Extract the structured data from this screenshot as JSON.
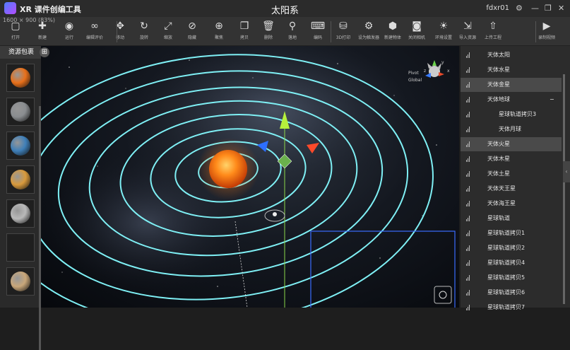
{
  "app": {
    "name": "XR 课件创编工具",
    "title": "太阳系",
    "user": "fdxr01",
    "resolution": "1600 × 900 (83%)"
  },
  "toolbar": [
    {
      "label": "打开",
      "icon": "folder-icon",
      "glyph": "▢"
    },
    {
      "label": "新建",
      "icon": "new-file-icon",
      "glyph": "✚"
    },
    {
      "label": "运行",
      "icon": "eye-icon",
      "glyph": "◉"
    },
    {
      "label": "编辑评价",
      "icon": "link-icon",
      "glyph": "∞"
    },
    {
      "label": "移动",
      "icon": "move-icon",
      "glyph": "✥"
    },
    {
      "label": "旋转",
      "icon": "rotate-icon",
      "glyph": "↻"
    },
    {
      "label": "缩放",
      "icon": "scale-icon",
      "glyph": "⤢"
    },
    {
      "label": "隐藏",
      "icon": "hide-icon",
      "glyph": "⊘"
    },
    {
      "label": "聚焦",
      "icon": "focus-icon",
      "glyph": "⊕"
    },
    {
      "label": "拷贝",
      "icon": "copy-icon",
      "glyph": "❐"
    },
    {
      "label": "删除",
      "icon": "delete-icon",
      "glyph": "🗑"
    },
    {
      "label": "落地",
      "icon": "pin-icon",
      "glyph": "⚲"
    },
    {
      "label": "编码",
      "icon": "code-icon",
      "glyph": "⌨"
    },
    {
      "label": "3D打印",
      "icon": "print3d-icon",
      "glyph": "⛁"
    },
    {
      "label": "设为触发器",
      "icon": "trigger-icon",
      "glyph": "⚙"
    },
    {
      "label": "新建物体",
      "icon": "cube-icon",
      "glyph": "⬢"
    },
    {
      "label": "关闭相机",
      "icon": "camera-icon",
      "glyph": "◙"
    },
    {
      "label": "环境设置",
      "icon": "sun-icon",
      "glyph": "☀"
    },
    {
      "label": "导入资源",
      "icon": "import-icon",
      "glyph": "⇲"
    },
    {
      "label": "上传工程",
      "icon": "upload-icon",
      "glyph": "⇧"
    },
    {
      "label": "录制视频",
      "icon": "video-icon",
      "glyph": "▶"
    }
  ],
  "resources": {
    "title": "资源包裹",
    "items": [
      {
        "name": "sun",
        "color": "#e8701a"
      },
      {
        "name": "mercury",
        "color": "#8a8d90"
      },
      {
        "name": "earth",
        "color": "#3f7fb8"
      },
      {
        "name": "venus",
        "color": "#d99a3c"
      },
      {
        "name": "moon",
        "color": "#b9b9b9"
      },
      {
        "name": "empty",
        "color": ""
      },
      {
        "name": "jupiter",
        "color": "#c9a77a"
      }
    ]
  },
  "hierarchy": {
    "items": [
      {
        "label": "天体太阳",
        "indent": 0,
        "selected": false,
        "toggle": ""
      },
      {
        "label": "天体水星",
        "indent": 0,
        "selected": false,
        "toggle": ""
      },
      {
        "label": "天体金星",
        "indent": 0,
        "selected": true,
        "toggle": ""
      },
      {
        "label": "天体地球",
        "indent": 0,
        "selected": false,
        "toggle": "−"
      },
      {
        "label": "星球轨道拷贝3",
        "indent": 1,
        "selected": false,
        "toggle": ""
      },
      {
        "label": "天体月球",
        "indent": 1,
        "selected": false,
        "toggle": ""
      },
      {
        "label": "天体火星",
        "indent": 0,
        "selected": true,
        "toggle": ""
      },
      {
        "label": "天体木星",
        "indent": 0,
        "selected": false,
        "toggle": ""
      },
      {
        "label": "天体土星",
        "indent": 0,
        "selected": false,
        "toggle": ""
      },
      {
        "label": "天体天王星",
        "indent": 0,
        "selected": false,
        "toggle": ""
      },
      {
        "label": "天体海王星",
        "indent": 0,
        "selected": false,
        "toggle": ""
      },
      {
        "label": "星球轨道",
        "indent": 0,
        "selected": false,
        "toggle": ""
      },
      {
        "label": "星球轨道拷贝1",
        "indent": 0,
        "selected": false,
        "toggle": ""
      },
      {
        "label": "星球轨道拷贝2",
        "indent": 0,
        "selected": false,
        "toggle": ""
      },
      {
        "label": "星球轨道拷贝4",
        "indent": 0,
        "selected": false,
        "toggle": ""
      },
      {
        "label": "星球轨道拷贝5",
        "indent": 0,
        "selected": false,
        "toggle": ""
      },
      {
        "label": "星球轨道拷贝6",
        "indent": 0,
        "selected": false,
        "toggle": ""
      },
      {
        "label": "星球轨道拷贝7",
        "indent": 0,
        "selected": false,
        "toggle": ""
      }
    ]
  },
  "viewport": {
    "gizmo_pivot": "Pivot",
    "gizmo_space": "Global",
    "axis_x": "x",
    "axis_y": "y",
    "axis_z": "z",
    "orbit_color": "#7ff0f5"
  }
}
